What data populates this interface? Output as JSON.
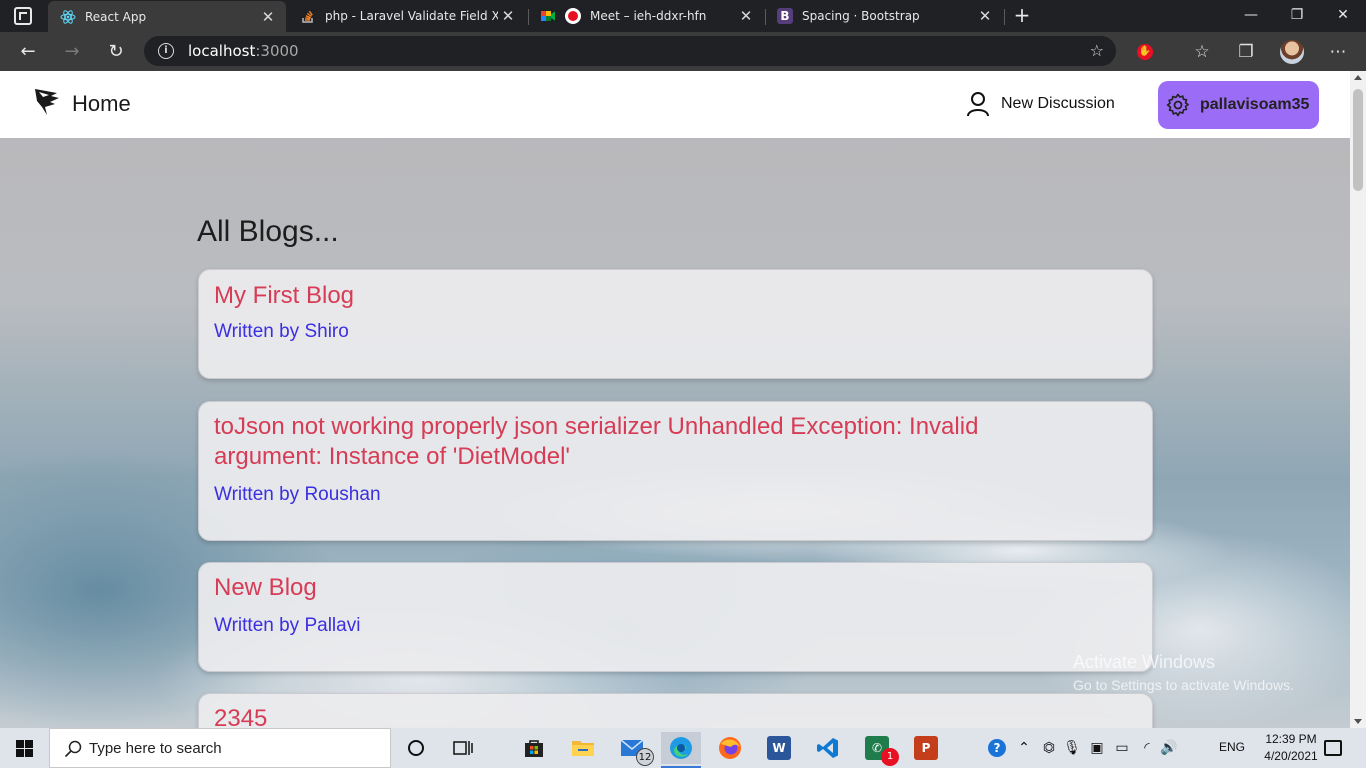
{
  "browser": {
    "tabs": [
      {
        "title": "React App",
        "close": "✕",
        "icon": "react-icon",
        "active": true
      },
      {
        "title": "php - Laravel Validate Field X if F",
        "close": "✕",
        "icon": "stackoverflow-icon",
        "active": false
      },
      {
        "title": "Meet – ieh-ddxr-hfn",
        "close": "✕",
        "icon": "google-meet-icon",
        "active": false
      },
      {
        "title": "Spacing · Bootstrap",
        "close": "✕",
        "icon": "bootstrap-icon",
        "active": false
      }
    ],
    "new_tab": "+",
    "window_controls": {
      "minimize": "—",
      "maximize": "❐",
      "close": "✕"
    },
    "url_host": "localhost",
    "url_port": ":3000",
    "nav": {
      "back": "←",
      "forward": "→",
      "refresh": "↻"
    }
  },
  "navbar": {
    "brand": "Home",
    "new_discussion": "New Discussion",
    "username": "pallavisoam35",
    "profile_color": "#9b6cf5"
  },
  "page": {
    "title": "All Blogs...",
    "blogs": [
      {
        "title": "My First Blog",
        "byline": "Written by Shiro"
      },
      {
        "title": "toJson not working properly json serializer Unhandled Exception: Invalid",
        "title2": "argument: Instance of 'DietModel'",
        "byline": "Written by Roushan"
      },
      {
        "title": "New Blog",
        "byline": "Written by Pallavi"
      },
      {
        "title": "2345",
        "byline": ""
      }
    ],
    "title_color": "#d63c55",
    "byline_color": "#3b2fe0"
  },
  "watermark": {
    "line1": "Activate Windows",
    "line2": "Go to Settings to activate Windows."
  },
  "taskbar": {
    "search_placeholder": "Type here to search",
    "mail_badge": "12",
    "whatsapp_badge": "1",
    "language": "ENG",
    "time": "12:39 PM",
    "date": "4/20/2021",
    "apps": [
      "cortana-icon",
      "task-view-icon",
      "store-icon",
      "file-explorer-icon",
      "mail-icon",
      "edge-icon",
      "firefox-icon",
      "word-icon",
      "vscode-icon",
      "whatsapp-icon",
      "powerpoint-icon"
    ]
  }
}
